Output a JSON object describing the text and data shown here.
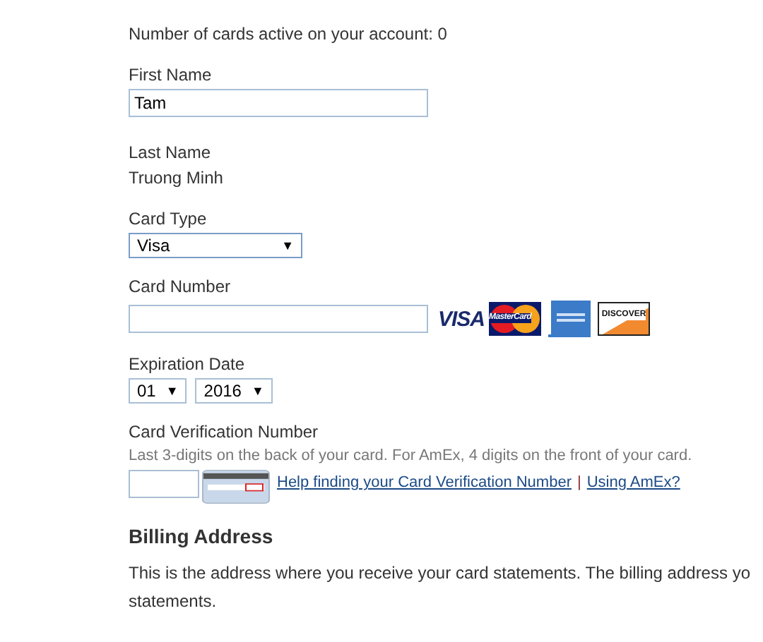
{
  "active_cards_note": "Number of cards active on your account: 0",
  "first_name": {
    "label": "First Name",
    "value": "Tam"
  },
  "last_name": {
    "label": "Last Name",
    "value": "Truong Minh"
  },
  "card_type": {
    "label": "Card Type",
    "value": "Visa",
    "caret": "▼"
  },
  "card_number": {
    "label": "Card Number",
    "logos": [
      {
        "kind": "visa",
        "text": "VISA"
      },
      {
        "kind": "mastercard",
        "text": "MasterCard"
      },
      {
        "kind": "amex"
      },
      {
        "kind": "discover",
        "text": "DISCOVER"
      }
    ]
  },
  "expiration": {
    "label": "Expiration Date",
    "selects": [
      {
        "value": "01",
        "caret": "▼"
      },
      {
        "value": "2016",
        "caret": "▼"
      }
    ]
  },
  "cvn": {
    "label": "Card Verification Number",
    "hint": "Last 3-digits on the back of your card. For AmEx, 4 digits on the front of your card.",
    "links": [
      "Help finding your Card Verification Number",
      "Using AmEx?"
    ],
    "separator": "|"
  },
  "billing": {
    "heading": "Billing Address",
    "text": "This is the address where you receive your card statements. The billing address yo\nstatements."
  }
}
